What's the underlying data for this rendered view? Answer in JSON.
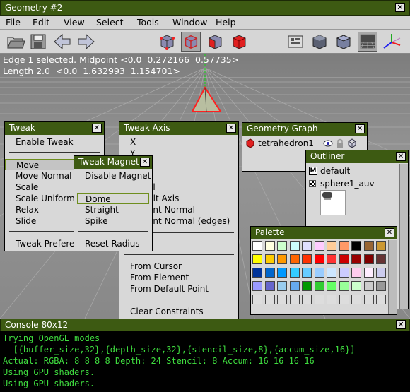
{
  "window": {
    "title": "Geometry #2",
    "close": "✕"
  },
  "menu": [
    "File",
    "Edit",
    "View",
    "Select",
    "Tools",
    "Window",
    "Help"
  ],
  "toolbar": {
    "left_icons": [
      "open-folder-icon",
      "save-icon",
      "undo-arrow-icon",
      "redo-arrow-icon"
    ],
    "mode_icons": [
      "vertex-select-icon",
      "edge-select-icon",
      "face-select-icon",
      "body-select-icon"
    ],
    "right_icons": [
      "perspective-icon",
      "smooth-shaded-icon",
      "flat-shaded-icon",
      "wireframe-ground-icon",
      "axes-icon"
    ]
  },
  "viewport": {
    "line1": "Edge 1 selected. Midpoint <0.0  0.272166  0.57735>",
    "line2": "Length 2.0  <0.0  1.632993  1.154701>"
  },
  "tweak": {
    "title": "Tweak",
    "items": [
      "Enable Tweak",
      "Move",
      "Move Normal",
      "Scale",
      "Scale Uniform",
      "Relax",
      "Slide",
      "Tweak Preferences"
    ]
  },
  "tweak_magnet": {
    "title": "Tweak Magnet",
    "items": [
      "Disable Magnet",
      "Dome",
      "Straight",
      "Spike",
      "Reset Radius"
    ]
  },
  "tweak_axis": {
    "title": "Tweak Axis",
    "items": [
      "X",
      "Y",
      "al",
      "ult Axis",
      "ent Normal",
      "ent Normal (edges)",
      "From Cursor",
      "From Element",
      "From Default Point",
      "Clear Constraints"
    ]
  },
  "geometry_graph": {
    "title": "Geometry Graph",
    "item": "tetrahedron1"
  },
  "outliner": {
    "title": "Outliner",
    "items": [
      "default",
      "sphere1_auv"
    ]
  },
  "palette": {
    "title": "Palette",
    "colors": [
      "#ffffff",
      "#ffffe0",
      "#ccffcc",
      "#ccffff",
      "#e0e0ff",
      "#ffccff",
      "#ffcc99",
      "#ff9966",
      "#000000",
      "#996633",
      "#cc9933",
      "#ffff00",
      "#ffcc00",
      "#ff9900",
      "#ff6600",
      "#ff3300",
      "#ff0000",
      "#ff3333",
      "#cc0000",
      "#990000",
      "#800000",
      "#663333",
      "#003399",
      "#0066cc",
      "#0099ff",
      "#33ccff",
      "#66ccff",
      "#99ccff",
      "#cce6ff",
      "#ccccff",
      "#ffccee",
      "#ffeeff",
      "#ccccee",
      "#9999ff",
      "#6666cc",
      "#99ccee",
      "#66aaee",
      "#009900",
      "#33cc33",
      "#66ff66",
      "#99ff99",
      "#ccffcc",
      "#cccccc",
      "#999999",
      "#dddddd",
      "#dddddd",
      "#dddddd",
      "#dddddd",
      "#dddddd",
      "#dddddd",
      "#dddddd",
      "#dddddd",
      "#dddddd",
      "#dddddd",
      "#dddddd"
    ]
  },
  "console": {
    "title": "Console 80x12",
    "lines": [
      "Trying OpenGL modes",
      "  [{buffer_size,32},{depth_size,32},{stencil_size,8},{accum_size,16}]",
      "Actual: RGBA: 8 8 8 8 Depth: 24 Stencil: 8 Accum: 16 16 16 16",
      "Using GPU shaders.",
      "Using GPU shaders."
    ]
  }
}
